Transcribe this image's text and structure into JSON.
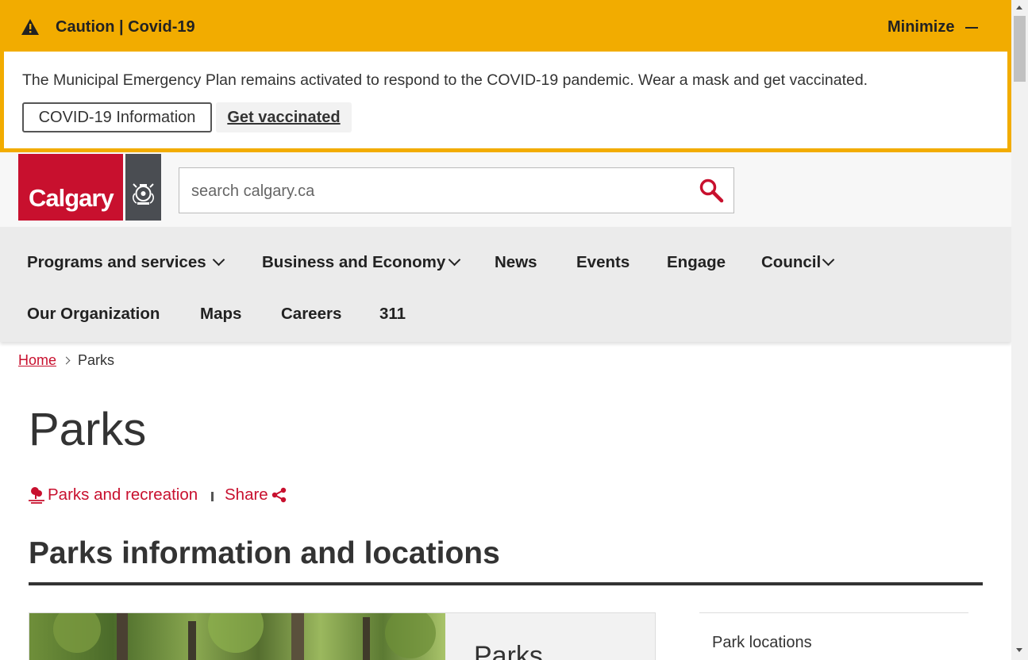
{
  "alert": {
    "title": "Caution | Covid-19",
    "minimize_label": "Minimize",
    "message": "The Municipal Emergency Plan remains activated to respond to the COVID-19 pandemic. Wear a mask and get vaccinated.",
    "buttons": [
      "COVID-19 Information",
      "Get vaccinated"
    ],
    "color": "#f2ac00"
  },
  "header": {
    "logo_text": "Calgary",
    "brand_color": "#c8102e",
    "search_placeholder": "search calgary.ca"
  },
  "nav": {
    "items": [
      {
        "label": "Programs and services",
        "has_dropdown": true
      },
      {
        "label": "Business and Economy",
        "has_dropdown": true
      },
      {
        "label": "News",
        "has_dropdown": false
      },
      {
        "label": "Events",
        "has_dropdown": false
      },
      {
        "label": "Engage",
        "has_dropdown": false
      },
      {
        "label": "Council",
        "has_dropdown": true
      },
      {
        "label": "Our Organization",
        "has_dropdown": false
      },
      {
        "label": "Maps",
        "has_dropdown": false
      },
      {
        "label": "Careers",
        "has_dropdown": false
      },
      {
        "label": "311",
        "has_dropdown": false
      }
    ]
  },
  "breadcrumb": {
    "home": "Home",
    "current": "Parks"
  },
  "page": {
    "title": "Parks",
    "tag_label": "Parks and recreation",
    "share_label": "Share",
    "section_title": "Parks information and locations",
    "card_title": "Parks",
    "side_links": [
      "Park locations"
    ]
  }
}
